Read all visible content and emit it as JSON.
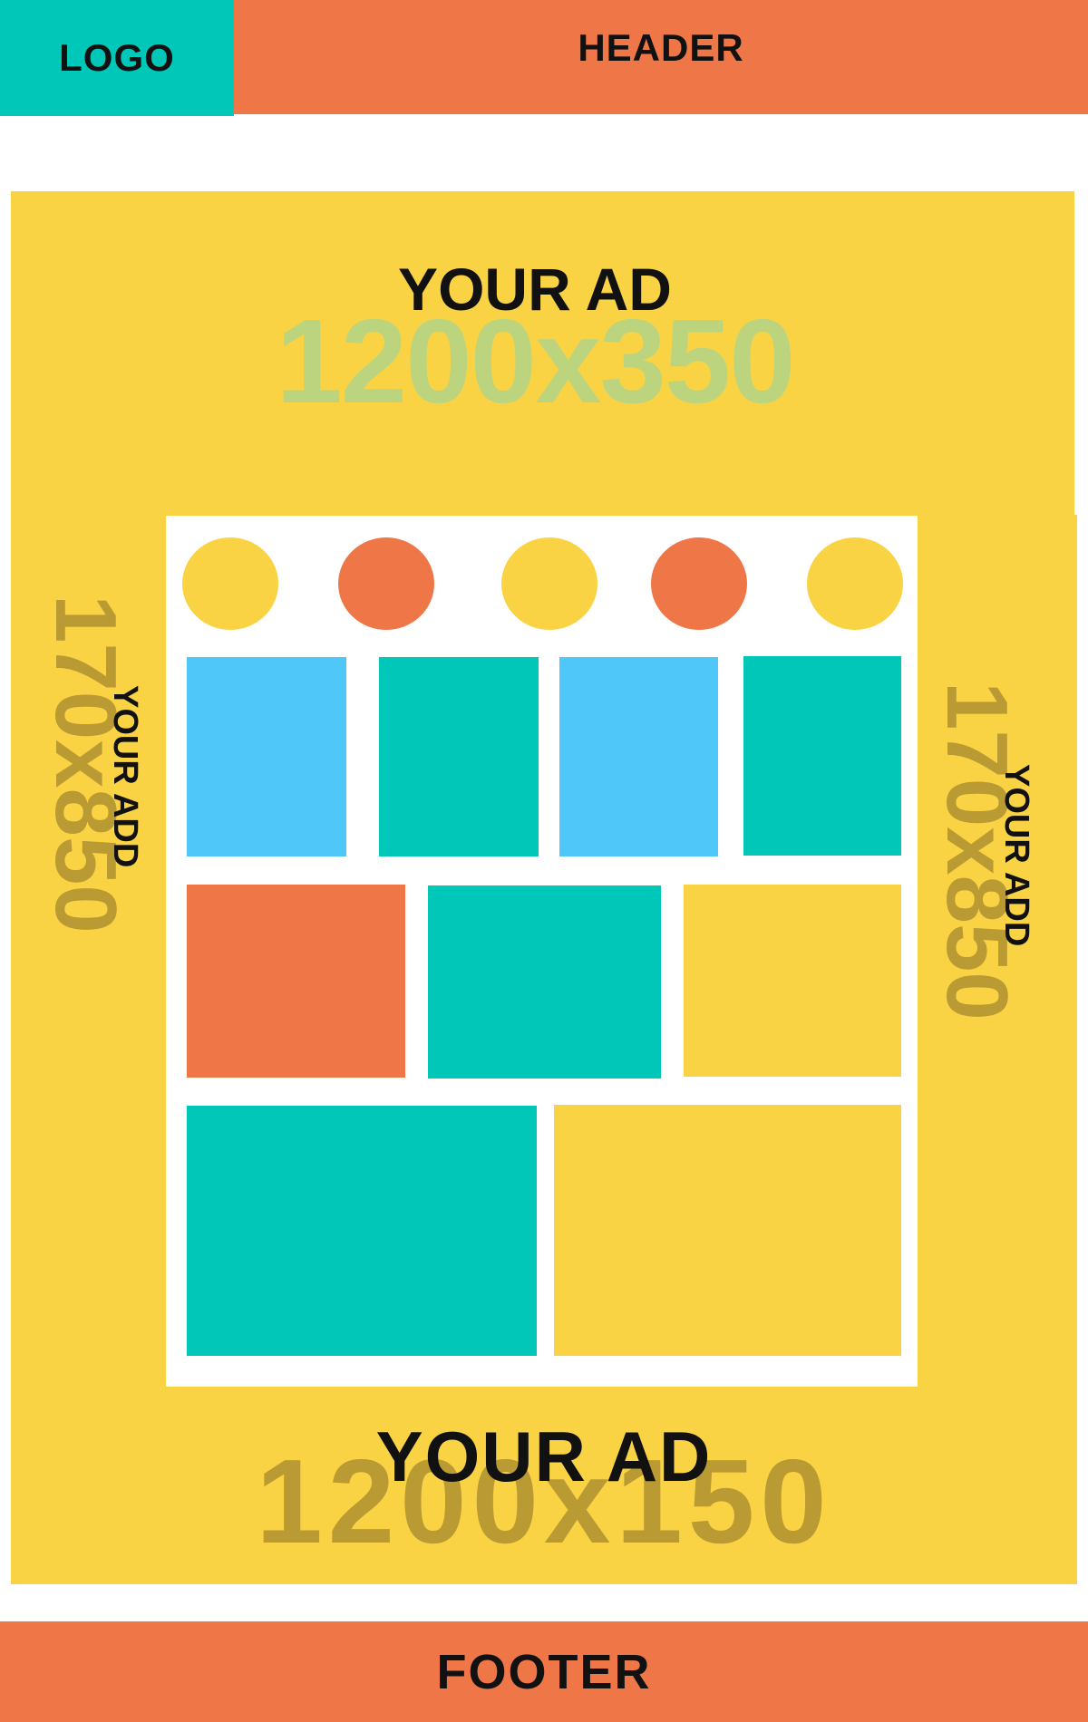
{
  "logo": {
    "text": "LOGO"
  },
  "header": {
    "text": "HEADER"
  },
  "top_ad": {
    "label": "YOUR AD",
    "size": "1200x350"
  },
  "left_ad": {
    "label": "YOUR ADD",
    "size": "170x850"
  },
  "right_ad": {
    "label": "YOUR ADD",
    "size": "170x850"
  },
  "bottom_ad": {
    "label": "YOUR AD",
    "size": "1200x150"
  },
  "footer": {
    "text": "FOOTER"
  },
  "colors": {
    "orange": "#EF7647",
    "teal": "#00C7B7",
    "yellow": "#FAD344",
    "blue": "#4FC8F9",
    "white": "#FFFFFF",
    "faded_green": "#BDD47E",
    "olive": "#BA9A33"
  },
  "content": {
    "circles": [
      "yellow",
      "orange",
      "yellow",
      "orange",
      "yellow"
    ],
    "tile_rows": [
      [
        "blue",
        "teal",
        "blue",
        "teal"
      ],
      [
        "orange",
        "teal",
        "yellow"
      ],
      [
        "teal",
        "yellow"
      ]
    ]
  }
}
